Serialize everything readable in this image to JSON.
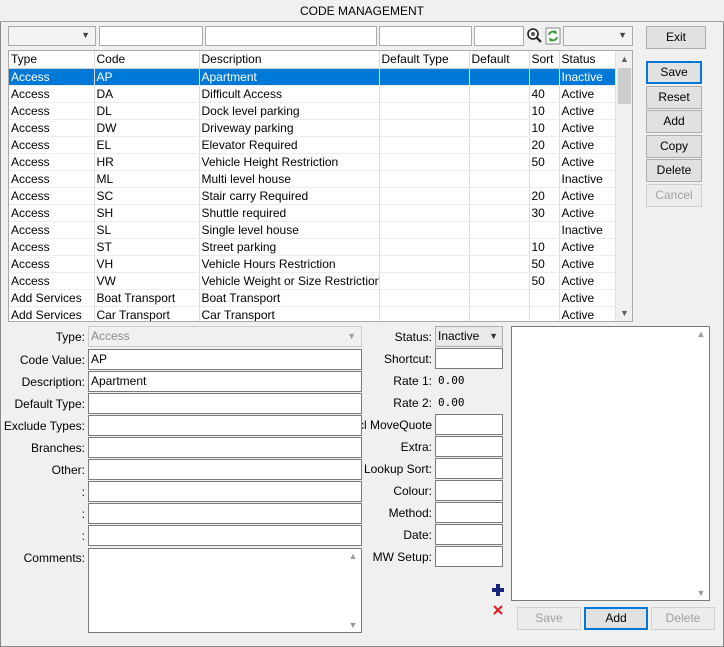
{
  "window": {
    "title": "CODE MANAGEMENT"
  },
  "grid": {
    "columns": [
      "Type",
      "Code",
      "Description",
      "Default Type",
      "Default",
      "Sort",
      "Status"
    ],
    "rows": [
      [
        "Access",
        "AP",
        "Apartment",
        "",
        "",
        "",
        "Inactive"
      ],
      [
        "Access",
        "DA",
        "Difficult Access",
        "",
        "",
        "40",
        "Active"
      ],
      [
        "Access",
        "DL",
        "Dock level parking",
        "",
        "",
        "10",
        "Active"
      ],
      [
        "Access",
        "DW",
        "Driveway parking",
        "",
        "",
        "10",
        "Active"
      ],
      [
        "Access",
        "EL",
        "Elevator Required",
        "",
        "",
        "20",
        "Active"
      ],
      [
        "Access",
        "HR",
        "Vehicle Height Restriction",
        "",
        "",
        "50",
        "Active"
      ],
      [
        "Access",
        "ML",
        "Multi level house",
        "",
        "",
        "",
        "Inactive"
      ],
      [
        "Access",
        "SC",
        "Stair carry Required",
        "",
        "",
        "20",
        "Active"
      ],
      [
        "Access",
        "SH",
        "Shuttle required",
        "",
        "",
        "30",
        "Active"
      ],
      [
        "Access",
        "SL",
        "Single level house",
        "",
        "",
        "",
        "Inactive"
      ],
      [
        "Access",
        "ST",
        "Street parking",
        "",
        "",
        "10",
        "Active"
      ],
      [
        "Access",
        "VH",
        "Vehicle Hours Restriction",
        "",
        "",
        "50",
        "Active"
      ],
      [
        "Access",
        "VW",
        "Vehicle Weight or Size Restriction",
        "",
        "",
        "50",
        "Active"
      ],
      [
        "Add Services",
        "Boat Transport",
        "Boat Transport",
        "",
        "",
        "",
        "Active"
      ],
      [
        "Add Services",
        "Car Transport",
        "Car Transport",
        "",
        "",
        "",
        "Active"
      ]
    ],
    "selected_row": 0
  },
  "buttons": {
    "exit": "Exit",
    "save": "Save",
    "reset": "Reset",
    "add": "Add",
    "copy": "Copy",
    "delete": "Delete",
    "cancel": "Cancel"
  },
  "form": {
    "type_label": "Type:",
    "type_value": "Access",
    "code_value_label": "Code Value:",
    "code_value": "AP",
    "description_label": "Description:",
    "description_value": "Apartment",
    "default_type_label": "Default Type:",
    "exclude_types_label": "Exclude Types:",
    "branches_label": "Branches:",
    "other_label": "Other:",
    "colon1": ":",
    "colon2": ":",
    "colon3": ":",
    "comments_label": "Comments:",
    "status_label": "Status:",
    "status_value": "Inactive",
    "shortcut_label": "Shortcut:",
    "rate1_label": "Rate 1:",
    "rate1_value": "0.00",
    "rate2_label": "Rate 2:",
    "rate2_value": "0.00",
    "movequote_label": "cl MoveQuote:",
    "extra_label": "Extra:",
    "lookup_sort_label": "Lookup Sort:",
    "colour_label": "Colour:",
    "method_label": "Method:",
    "date_label": "Date:",
    "mw_setup_label": "MW Setup:"
  },
  "list_panel": {
    "save": "Save",
    "add": "Add",
    "delete": "Delete"
  },
  "icons": {
    "search": "search-icon",
    "refresh": "refresh-icon",
    "plus": "plus-icon",
    "remove": "remove-icon"
  },
  "colors": {
    "selection": "#0078d7",
    "plus": "#1a237e",
    "remove": "#e02020",
    "refresh": "#2e9e2e"
  }
}
